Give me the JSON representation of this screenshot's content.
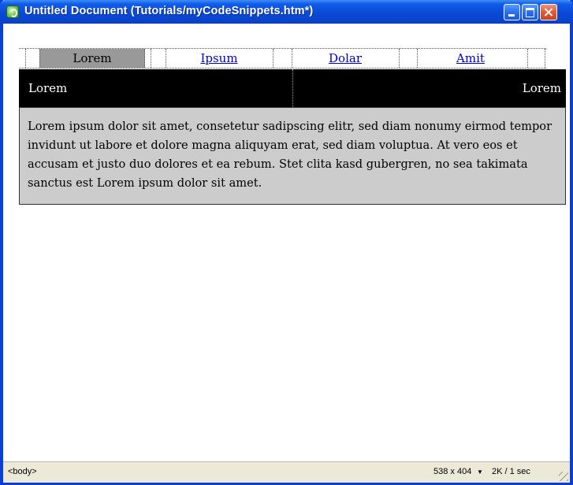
{
  "window": {
    "title": "Untitled Document (Tutorials/myCodeSnippets.htm*)"
  },
  "nav": {
    "tabs": [
      {
        "label": "Lorem",
        "active": true
      },
      {
        "label": "Ipsum",
        "active": false
      },
      {
        "label": "Dolar",
        "active": false
      },
      {
        "label": "Amit",
        "active": false
      }
    ]
  },
  "header": {
    "left_text": "Lorem",
    "right_text": "Lorem"
  },
  "body_text": "Lorem ipsum dolor sit amet, consetetur sadipscing elitr, sed diam nonumy eirmod tempor invidunt ut labore et dolore magna aliquyam erat, sed diam voluptua. At vero eos et accusam et justo duo dolores et ea rebum. Stet clita kasd gubergren, no sea takimata sanctus est Lorem ipsum dolor sit amet.",
  "status": {
    "tag": "<body>",
    "window_size": "538 x 404",
    "download_time": "2K / 1 sec"
  },
  "colors": {
    "titlebar": "#0a4ad6",
    "active_tab": "#999999",
    "header_bar": "#000000",
    "content_box": "#cccccc",
    "link": "#0000cc"
  },
  "icons": {
    "app": "app-logo-icon",
    "dropdown": "chevron-down-icon"
  }
}
